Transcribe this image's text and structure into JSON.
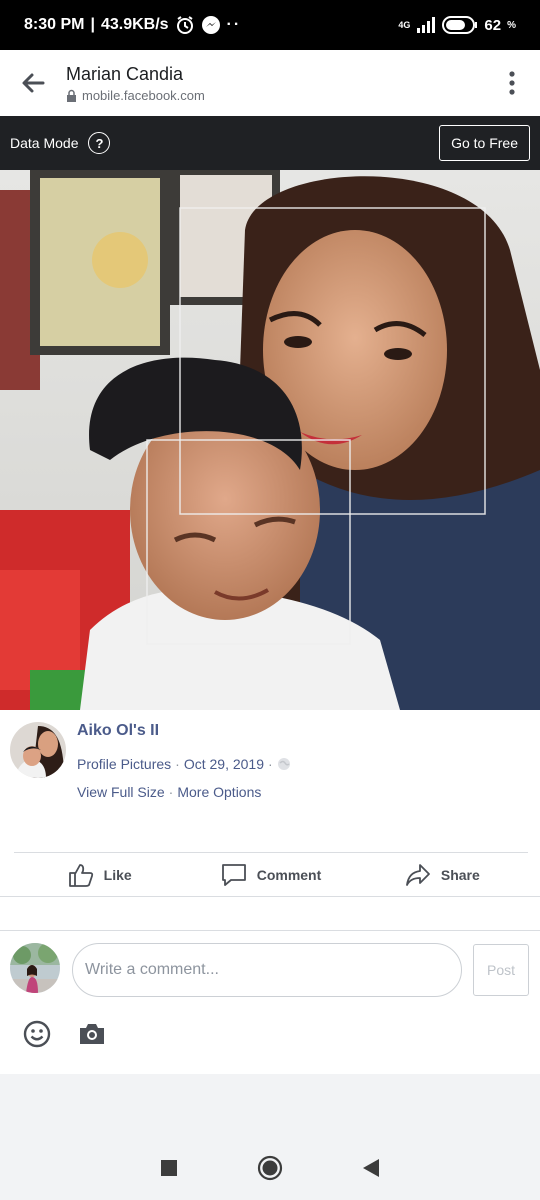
{
  "status_bar": {
    "time": "8:30 PM",
    "network_speed": "43.9KB/s",
    "network_type": "4G",
    "battery": "62",
    "battery_unit": "%",
    "icons": [
      "alarm-icon",
      "messenger-icon",
      "more-dots-icon",
      "signal-icon",
      "battery-icon"
    ]
  },
  "browser": {
    "title": "Marian Candia",
    "url": "mobile.facebook.com"
  },
  "data_bar": {
    "label": "Data Mode",
    "help": "?",
    "button": "Go to Free"
  },
  "post": {
    "owner": "Aiko Ol's II",
    "album": "Profile Pictures",
    "date": "Oct 29, 2019",
    "sep": "·",
    "view_full": "View Full Size",
    "more_options": "More Options"
  },
  "actions": {
    "like": "Like",
    "comment": "Comment",
    "share": "Share"
  },
  "comment_box": {
    "placeholder": "Write a comment...",
    "post": "Post"
  },
  "colors": {
    "link": "#4b5b8a",
    "data_bar_bg": "#1f2124",
    "divider": "#dadde1"
  }
}
